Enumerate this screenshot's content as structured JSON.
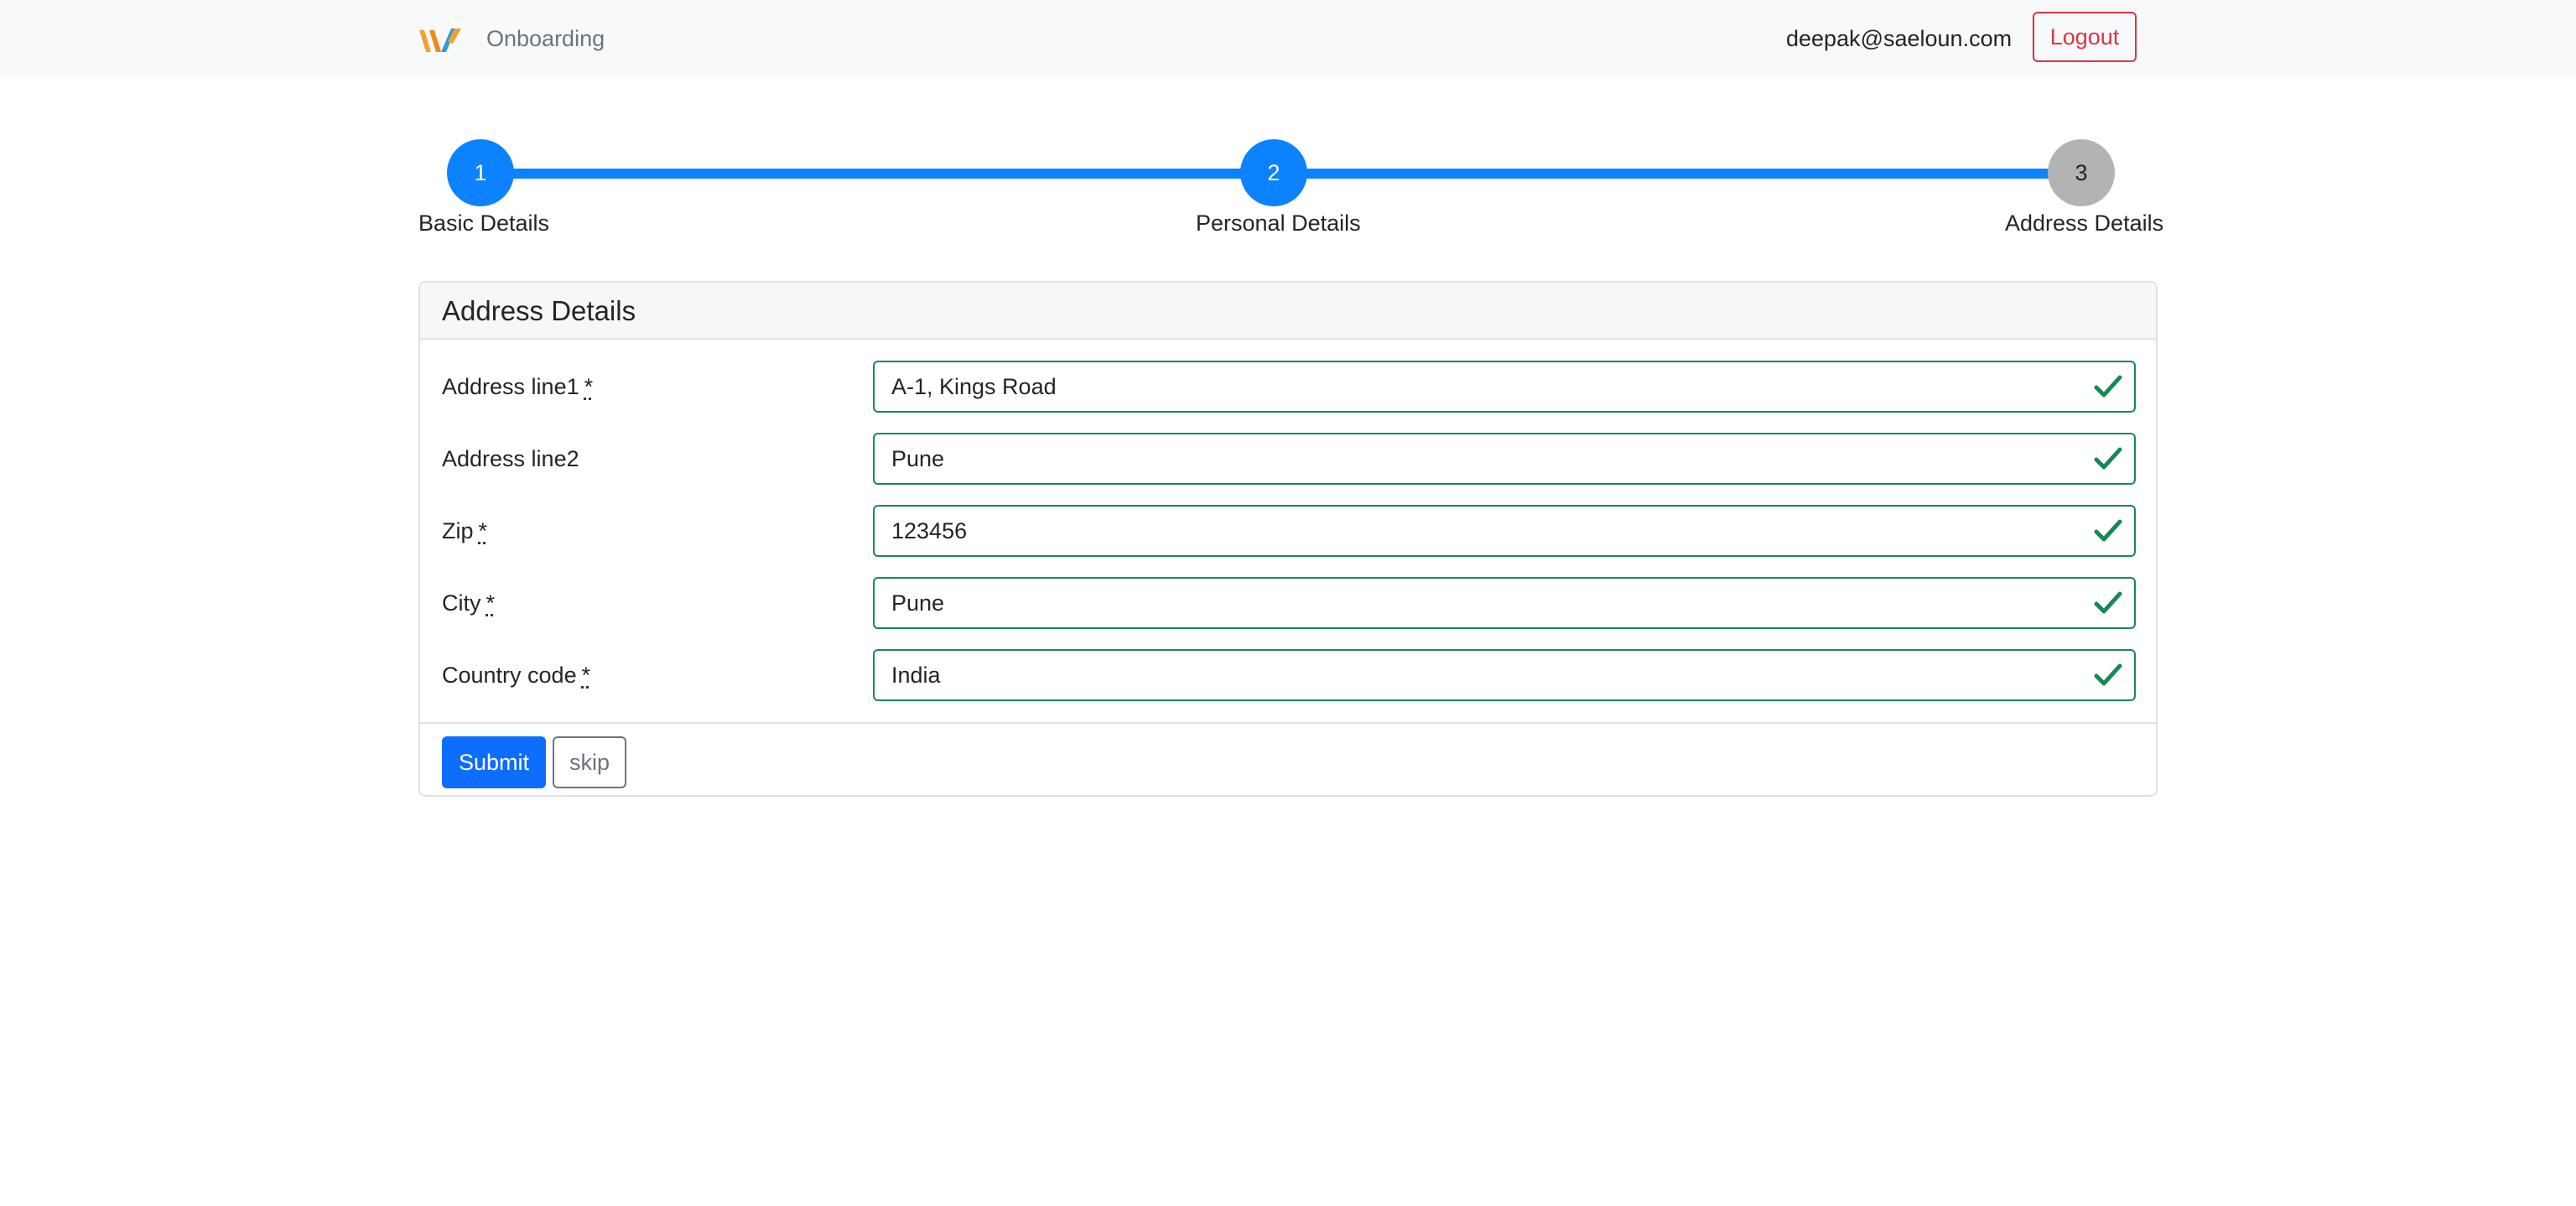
{
  "navbar": {
    "brand": "Onboarding",
    "user_email": "deepak@saeloun.com",
    "logout_label": "Logout"
  },
  "stepper": {
    "steps": [
      {
        "number": "1",
        "label": "Basic Details",
        "state": "completed"
      },
      {
        "number": "2",
        "label": "Personal Details",
        "state": "completed"
      },
      {
        "number": "3",
        "label": "Address Details",
        "state": "current"
      }
    ]
  },
  "form": {
    "title": "Address Details",
    "required_marker": "*",
    "fields": [
      {
        "label": "Address line1",
        "required": true,
        "value": "A-1, Kings Road"
      },
      {
        "label": "Address line2",
        "required": false,
        "value": "Pune"
      },
      {
        "label": "Zip",
        "required": true,
        "value": "123456"
      },
      {
        "label": "City",
        "required": true,
        "value": "Pune"
      },
      {
        "label": "Country code",
        "required": true,
        "value": "India"
      }
    ],
    "submit_label": "Submit",
    "skip_label": "skip"
  },
  "colors": {
    "primary": "#0d82ff",
    "valid": "#198754",
    "danger": "#dc3545",
    "pending_step": "#b3b3b3"
  }
}
